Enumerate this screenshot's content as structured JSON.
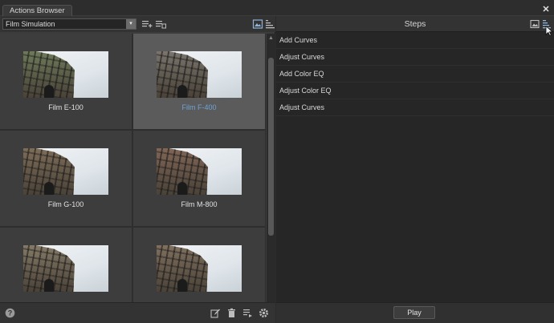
{
  "window": {
    "tab_title": "Actions Browser",
    "close_glyph": "✕"
  },
  "left_panel": {
    "category_select": {
      "value": "Film Simulation",
      "arrow_glyph": "▾"
    },
    "toolbar_icons": [
      "add-action-icon",
      "delete-action-icon",
      "view-thumbnails-icon",
      "view-list-icon"
    ],
    "presets": [
      {
        "label": "Film E-100",
        "selected": false,
        "tint": "#6e7a5a"
      },
      {
        "label": "Film F-400",
        "selected": true,
        "tint": "#7a746c"
      },
      {
        "label": "Film G-100",
        "selected": false,
        "tint": "#7e6d58"
      },
      {
        "label": "Film M-800",
        "selected": false,
        "tint": "#806656"
      },
      {
        "label": "",
        "selected": false,
        "tint": "#857a66"
      },
      {
        "label": "",
        "selected": false,
        "tint": "#80705e"
      }
    ],
    "footer_icons": [
      "help-icon",
      "edit-icon",
      "trash-icon",
      "list-add-icon",
      "gear-icon"
    ]
  },
  "right_panel": {
    "title": "Steps",
    "steps": [
      "Add Curves",
      "Adjust Curves",
      "Add Color EQ",
      "Adjust Color EQ",
      "Adjust Curves"
    ],
    "play_label": "Play"
  },
  "colors": {
    "accent_selected_text": "#6fa3d6",
    "panel_bg": "#262626"
  }
}
